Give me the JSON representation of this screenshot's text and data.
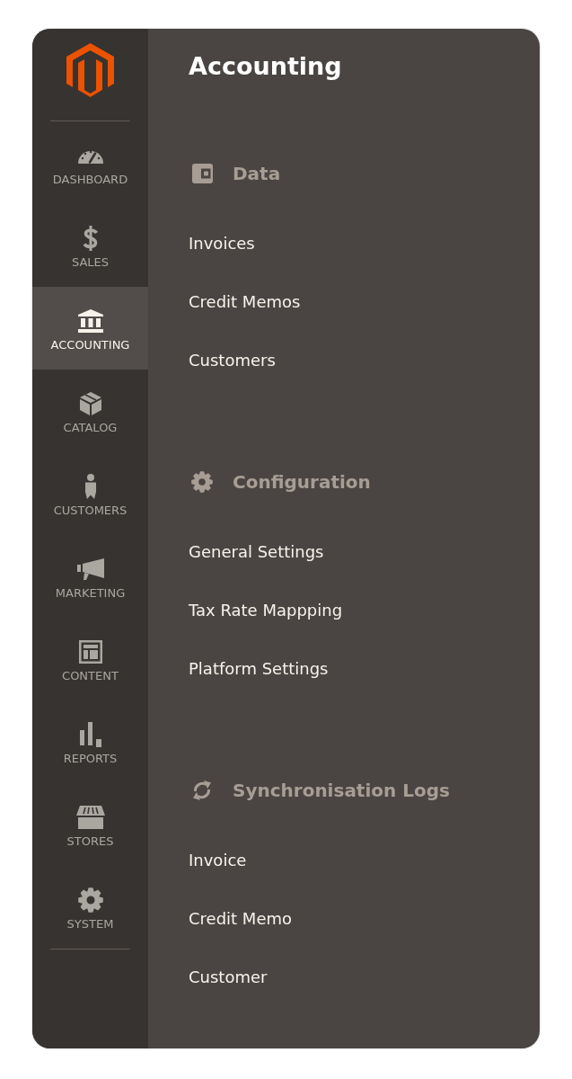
{
  "sidebar": {
    "items": [
      {
        "label": "DASHBOARD",
        "selected": false
      },
      {
        "label": "SALES",
        "selected": false
      },
      {
        "label": "ACCOUNTING",
        "selected": true
      },
      {
        "label": "CATALOG",
        "selected": false
      },
      {
        "label": "CUSTOMERS",
        "selected": false
      },
      {
        "label": "MARKETING",
        "selected": false
      },
      {
        "label": "CONTENT",
        "selected": false
      },
      {
        "label": "REPORTS",
        "selected": false
      },
      {
        "label": "STORES",
        "selected": false
      },
      {
        "label": "SYSTEM",
        "selected": false
      }
    ]
  },
  "panel": {
    "title": "Accounting",
    "sections": [
      {
        "heading": "Data",
        "items": [
          "Invoices",
          "Credit Memos",
          "Customers"
        ]
      },
      {
        "heading": "Configuration",
        "items": [
          "General Settings",
          "Tax Rate Mappping",
          "Platform Settings"
        ]
      },
      {
        "heading": "Synchronisation Logs",
        "items": [
          "Invoice",
          "Credit Memo",
          "Customer"
        ]
      }
    ]
  }
}
